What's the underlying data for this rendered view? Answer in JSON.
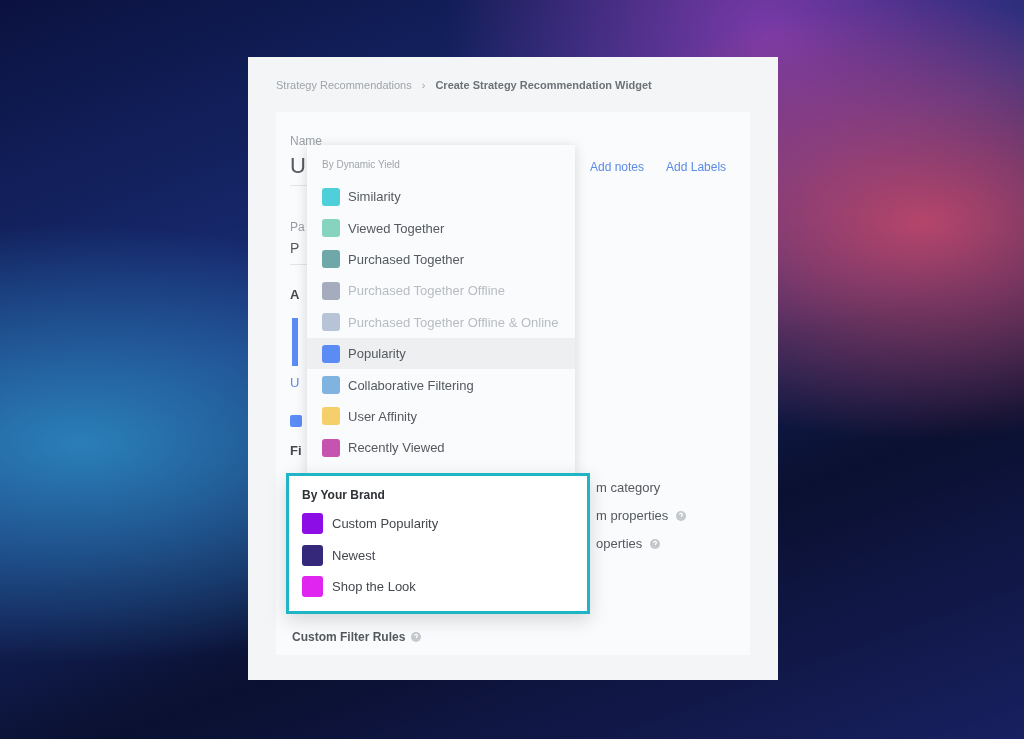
{
  "breadcrumb": [
    {
      "label": "Strategy Recommendations",
      "current": false
    },
    {
      "label": "Create Strategy Recommendation Widget",
      "current": true
    }
  ],
  "breadcrumb_separator": "›",
  "form": {
    "name_label": "Name",
    "name_value": "U",
    "links": [
      "Add notes",
      "Add Labels"
    ],
    "field_2_label": "Pa",
    "field_2_value": "P",
    "section_heading": "A",
    "link_text": "U",
    "checkbox_checked": true,
    "section_2_heading": "Fi",
    "options": [
      {
        "text": "m category",
        "info": false
      },
      {
        "text": "m properties",
        "info": true
      },
      {
        "text": "operties",
        "info": true
      }
    ],
    "custom_filter_rules": "Custom Filter Rules"
  },
  "dropdown": {
    "group": "By Dynamic Yield",
    "items": [
      {
        "label": "Similarity",
        "color": "#4fcfd9",
        "disabled": false,
        "selected": false
      },
      {
        "label": "Viewed Together",
        "color": "#86d3c0",
        "disabled": false,
        "selected": false
      },
      {
        "label": "Purchased Together",
        "color": "#6fa8a8",
        "disabled": false,
        "selected": false
      },
      {
        "label": "Purchased Together Offline",
        "color": "#a4acbd",
        "disabled": true,
        "selected": false
      },
      {
        "label": "Purchased Together Offline & Online",
        "color": "#b7c3d6",
        "disabled": true,
        "selected": false
      },
      {
        "label": "Popularity",
        "color": "#5b8cf5",
        "disabled": false,
        "selected": true
      },
      {
        "label": "Collaborative Filtering",
        "color": "#7fb3e0",
        "disabled": false,
        "selected": false
      },
      {
        "label": "User Affinity",
        "color": "#f5cf6a",
        "disabled": false,
        "selected": false
      },
      {
        "label": "Recently Viewed",
        "color": "#c653b0",
        "disabled": false,
        "selected": false
      }
    ]
  },
  "brand_group": {
    "title": "By Your Brand",
    "items": [
      {
        "label": "Custom Popularity",
        "color": "#8c0de6"
      },
      {
        "label": "Newest",
        "color": "#35287a"
      },
      {
        "label": "Shop the Look",
        "color": "#e025f0"
      }
    ]
  }
}
